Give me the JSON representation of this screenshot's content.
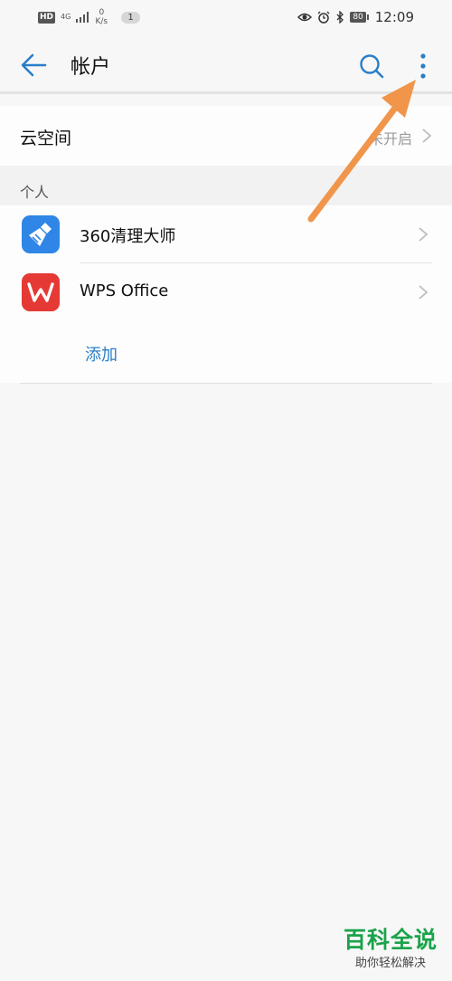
{
  "status_bar": {
    "hd": "HD",
    "network": "4G",
    "speed_value": "0",
    "speed_unit": "K/s",
    "notification_count": "1",
    "battery": "80",
    "time": "12:09"
  },
  "header": {
    "title": "帐户"
  },
  "cloud": {
    "label": "云空间",
    "status": "未开启"
  },
  "section": {
    "label": "个人"
  },
  "accounts": [
    {
      "label": "360清理大师",
      "icon": "broom-icon",
      "color": "#2f86e6"
    },
    {
      "label": "WPS Office",
      "icon": "wps-icon",
      "color": "#e53935"
    }
  ],
  "add_label": "添加",
  "watermark": {
    "title": "百科全说",
    "subtitle": "助你轻松解决"
  },
  "colors": {
    "accent": "#2a7ec9",
    "annotation_arrow": "#f0954a"
  }
}
